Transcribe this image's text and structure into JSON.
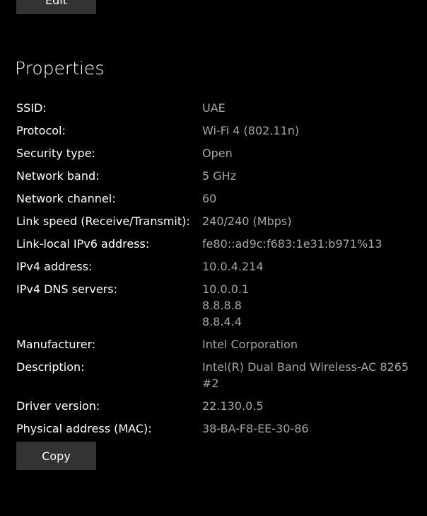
{
  "buttons": {
    "edit_label": "Edit",
    "copy_label": "Copy"
  },
  "section": {
    "title": "Properties"
  },
  "properties": [
    {
      "label": "SSID:",
      "values": [
        "UAE"
      ]
    },
    {
      "label": "Protocol:",
      "values": [
        "Wi-Fi 4 (802.11n)"
      ]
    },
    {
      "label": "Security type:",
      "values": [
        "Open"
      ]
    },
    {
      "label": "Network band:",
      "values": [
        "5 GHz"
      ]
    },
    {
      "label": "Network channel:",
      "values": [
        "60"
      ]
    },
    {
      "label": "Link speed (Receive/Transmit):",
      "values": [
        "240/240 (Mbps)"
      ]
    },
    {
      "label": "Link-local IPv6 address:",
      "values": [
        "fe80::ad9c:f683:1e31:b971%13"
      ]
    },
    {
      "label": "IPv4 address:",
      "values": [
        "10.0.4.214"
      ]
    },
    {
      "label": "IPv4 DNS servers:",
      "values": [
        "10.0.0.1",
        "8.8.8.8",
        "8.8.4.4"
      ]
    },
    {
      "label": "Manufacturer:",
      "values": [
        "Intel Corporation"
      ]
    },
    {
      "label": "Description:",
      "values": [
        "Intel(R) Dual Band Wireless-AC 8265",
        "#2"
      ]
    },
    {
      "label": "Driver version:",
      "values": [
        "22.130.0.5"
      ]
    },
    {
      "label": "Physical address (MAC):",
      "values": [
        "38-BA-F8-EE-30-86"
      ]
    }
  ],
  "colors": {
    "background": "#000000",
    "label_text": "#ffffff",
    "value_text": "#a6a6a6",
    "button_bg": "#333333"
  }
}
